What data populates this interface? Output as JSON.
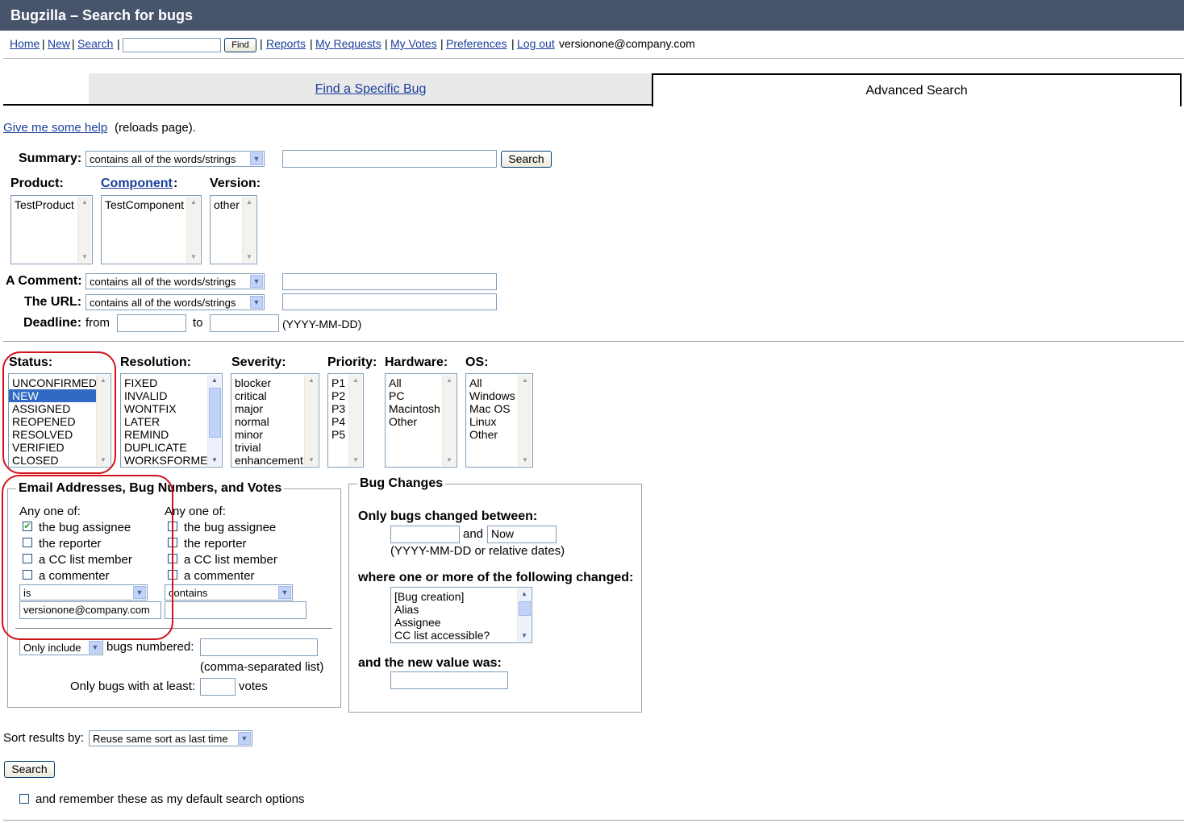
{
  "window": {
    "title": "Bugzilla – Search for bugs"
  },
  "nav": {
    "home": "Home",
    "new": "New",
    "search": "Search",
    "find_button": "Find",
    "reports": "Reports",
    "my_requests": "My Requests",
    "my_votes": "My Votes",
    "preferences": "Preferences",
    "logout": "Log out",
    "user": "versionone@company.com"
  },
  "tabs": {
    "find_specific": "Find a Specific Bug",
    "advanced": "Advanced Search"
  },
  "help": {
    "link": "Give me some help",
    "suffix": "(reloads page)."
  },
  "summary": {
    "label": "Summary:",
    "operator": "contains all of the words/strings",
    "button": "Search"
  },
  "product": {
    "label": "Product:",
    "options": [
      "TestProduct"
    ]
  },
  "component": {
    "label": "Component",
    "options": [
      "TestComponent"
    ]
  },
  "version": {
    "label": "Version:",
    "options": [
      "other"
    ]
  },
  "comment": {
    "label": "A Comment:",
    "operator": "contains all of the words/strings"
  },
  "url": {
    "label": "The URL:",
    "operator": "contains all of the words/strings"
  },
  "deadline": {
    "label": "Deadline:",
    "from": "from",
    "to": "to",
    "format": "(YYYY-MM-DD)"
  },
  "status": {
    "label": "Status:",
    "options": [
      "UNCONFIRMED",
      "NEW",
      "ASSIGNED",
      "REOPENED",
      "RESOLVED",
      "VERIFIED",
      "CLOSED"
    ],
    "selected": "NEW"
  },
  "resolution": {
    "label": "Resolution:",
    "options": [
      "FIXED",
      "INVALID",
      "WONTFIX",
      "LATER",
      "REMIND",
      "DUPLICATE",
      "WORKSFORME"
    ]
  },
  "severity": {
    "label": "Severity:",
    "options": [
      "blocker",
      "critical",
      "major",
      "normal",
      "minor",
      "trivial",
      "enhancement"
    ]
  },
  "priority": {
    "label": "Priority:",
    "options": [
      "P1",
      "P2",
      "P3",
      "P4",
      "P5"
    ]
  },
  "hardware": {
    "label": "Hardware:",
    "options": [
      "All",
      "PC",
      "Macintosh",
      "Other"
    ]
  },
  "os": {
    "label": "OS:",
    "options": [
      "All",
      "Windows",
      "Mac OS",
      "Linux",
      "Other"
    ]
  },
  "email": {
    "legend": "Email Addresses, Bug Numbers, and Votes",
    "col1": {
      "any_one_of": "Any one of:",
      "assignee": "the bug assignee",
      "reporter": "the reporter",
      "cc": "a CC list member",
      "commenter": "a commenter",
      "operator": "is",
      "value": "versionone@company.com",
      "assignee_checked": true
    },
    "col2": {
      "any_one_of": "Any one of:",
      "assignee": "the bug assignee",
      "reporter": "the reporter",
      "cc": "a CC list member",
      "commenter": "a commenter",
      "operator": "contains",
      "value": ""
    },
    "include_op": "Only include",
    "bugs_numbered": "bugs numbered:",
    "comma_note": "(comma-separated list)",
    "votes_prefix": "Only bugs with at least:",
    "votes_suffix": "votes"
  },
  "changes": {
    "legend": "Bug Changes",
    "between": "Only bugs changed between:",
    "and": "and",
    "to_value": "Now",
    "dates_note": "(YYYY-MM-DD or relative dates)",
    "where": "where one or more of the following changed:",
    "fields": [
      "[Bug creation]",
      "Alias",
      "Assignee",
      "CC list accessible?"
    ],
    "new_value": "and the new value was:"
  },
  "sort": {
    "label": "Sort results by:",
    "value": "Reuse same sort as last time"
  },
  "search_button": "Search",
  "remember": "and remember these as my default search options"
}
